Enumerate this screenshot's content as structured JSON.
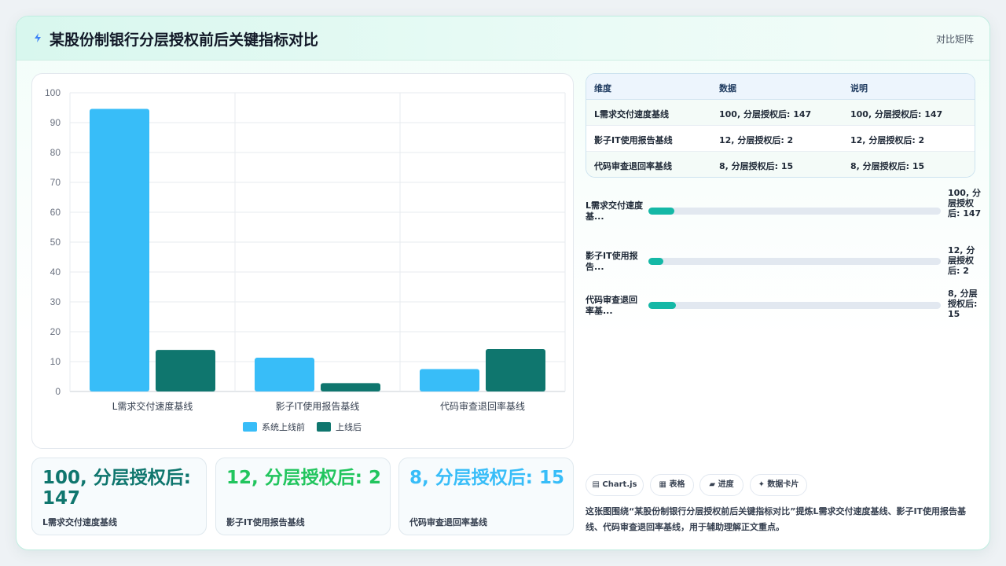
{
  "header": {
    "title": "某股份制银行分层授权前后关键指标对比",
    "right_label": "对比矩阵"
  },
  "colors": {
    "before": "#38bdf8",
    "after": "#0f766e",
    "progress": "#14b8a6",
    "stat1": "#0f766e",
    "stat2": "#22c55e",
    "stat3": "#38bdf8"
  },
  "chart_data": {
    "type": "bar",
    "categories": [
      "L需求交付速度基线",
      "影子IT使用报告基线",
      "代码审查退回率基线"
    ],
    "series": [
      {
        "name": "系统上线前",
        "values": [
          94.6,
          11.3,
          7.5
        ]
      },
      {
        "name": "上线后",
        "values": [
          13.9,
          2.8,
          14.2
        ]
      }
    ],
    "ylim": [
      0,
      100
    ],
    "yticks": [
      0,
      10,
      20,
      30,
      40,
      50,
      60,
      70,
      80,
      90,
      100
    ],
    "grid": true,
    "legend": "bottom"
  },
  "table": {
    "headers": [
      "维度",
      "数据",
      "说明"
    ],
    "rows": [
      [
        "L需求交付速度基线",
        "100, 分层授权后: 147",
        "100, 分层授权后: 147"
      ],
      [
        "影子IT使用报告基线",
        "12, 分层授权后: 2",
        "12, 分层授权后: 2"
      ],
      [
        "代码审查退回率基线",
        "8, 分层授权后: 15",
        "8, 分层授权后: 15"
      ]
    ]
  },
  "progress": [
    {
      "label": "L需求交付速度基...",
      "value_text": "100, 分层授权后: 147",
      "fill": 0.09
    },
    {
      "label": "影子IT使用报告...",
      "value_text": "12, 分层授权后: 2",
      "fill": 0.05
    },
    {
      "label": "代码审查退回率基...",
      "value_text": "8, 分层授权后: 15",
      "fill": 0.095
    }
  ],
  "stats": [
    {
      "big": "100, 分层授权后: 147",
      "small": "L需求交付速度基线"
    },
    {
      "big": "12, 分层授权后: 2",
      "small": "影子IT使用报告基线"
    },
    {
      "big": "8, 分层授权后: 15",
      "small": "代码审查退回率基线"
    }
  ],
  "tags": [
    "▤ Chart.js",
    "▦ 表格",
    "▰ 进度",
    "✦ 数据卡片"
  ],
  "description": "这张图围绕“某股份制银行分层授权前后关键指标对比”提炼L需求交付速度基线、影子IT使用报告基线、代码审查退回率基线，用于辅助理解正文重点。"
}
